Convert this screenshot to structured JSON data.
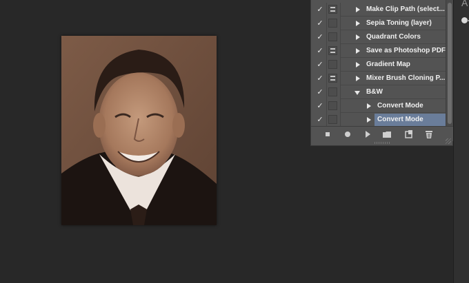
{
  "actions": [
    {
      "label": "Make Clip Path (select...",
      "checked": true,
      "dialog": true,
      "indent": 0,
      "expanded": false,
      "selected": false
    },
    {
      "label": "Sepia Toning (layer)",
      "checked": true,
      "dialog": false,
      "indent": 0,
      "expanded": false,
      "selected": false
    },
    {
      "label": "Quadrant Colors",
      "checked": true,
      "dialog": false,
      "indent": 0,
      "expanded": false,
      "selected": false
    },
    {
      "label": "Save as Photoshop PDF",
      "checked": true,
      "dialog": true,
      "indent": 0,
      "expanded": false,
      "selected": false
    },
    {
      "label": "Gradient Map",
      "checked": true,
      "dialog": false,
      "indent": 0,
      "expanded": false,
      "selected": false
    },
    {
      "label": "Mixer Brush Cloning P...",
      "checked": true,
      "dialog": true,
      "indent": 0,
      "expanded": false,
      "selected": false
    },
    {
      "label": "B&W",
      "checked": true,
      "dialog": false,
      "indent": 0,
      "expanded": true,
      "selected": false
    },
    {
      "label": "Convert Mode",
      "checked": true,
      "dialog": false,
      "indent": 1,
      "expanded": false,
      "selected": false
    },
    {
      "label": "Convert Mode",
      "checked": true,
      "dialog": false,
      "indent": 1,
      "expanded": false,
      "selected": true
    }
  ],
  "check_glyph": "✓",
  "toolbar": [
    "stop-icon",
    "record-icon",
    "play-icon",
    "new-set-icon",
    "new-action-icon",
    "trash-icon"
  ],
  "right_panel": {
    "glyph": "A"
  },
  "colors": {
    "selected_row": "#6a7d9a",
    "panel_bg": "#535353",
    "workspace_bg": "#282828"
  }
}
